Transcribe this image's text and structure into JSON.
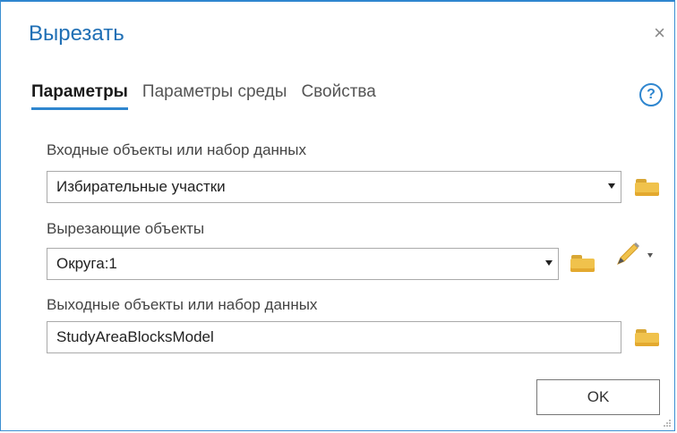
{
  "dialog": {
    "title": "Вырезать",
    "close_symbol": "×",
    "help_symbol": "?"
  },
  "tabs": [
    {
      "label": "Параметры",
      "active": true
    },
    {
      "label": "Параметры среды",
      "active": false
    },
    {
      "label": "Свойства",
      "active": false
    }
  ],
  "params": {
    "input": {
      "label": "Входные объекты или набор данных",
      "value": "Избирательные участки"
    },
    "clip": {
      "label": "Вырезающие объекты",
      "value": "Округа:1"
    },
    "output": {
      "label": "Выходные объекты или набор данных",
      "value": "StudyAreaBlocksModel"
    }
  },
  "buttons": {
    "ok": "OK"
  },
  "icons": {
    "folder": "folder-icon",
    "pencil": "pencil-icon",
    "help": "help-icon",
    "close": "close-icon"
  },
  "colors": {
    "accent": "#2f86cf",
    "title": "#1f6fb5",
    "folder": "#f0c24c"
  }
}
